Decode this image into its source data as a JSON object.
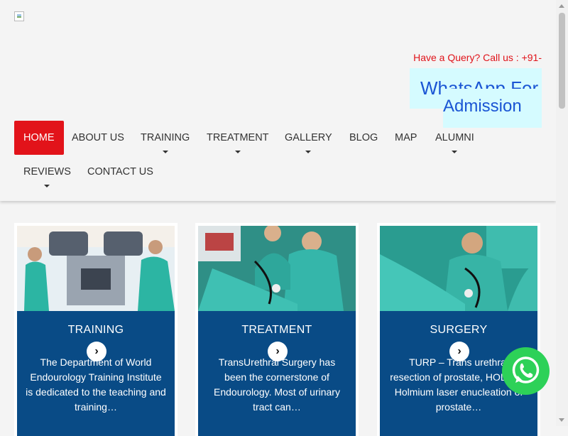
{
  "header": {
    "query_text": "Have a Query? Call us : +91-",
    "whatsapp_line1": "WhatsApp For",
    "whatsapp_line2": "Admission"
  },
  "nav": {
    "items": [
      {
        "label": "HOME",
        "active": true
      },
      {
        "label": "ABOUT US"
      },
      {
        "label": "TRAINING",
        "has_dropdown": true
      },
      {
        "label": "TREATMENT",
        "has_dropdown": true
      },
      {
        "label": "GALLERY",
        "has_dropdown": true
      },
      {
        "label": "BLOG"
      },
      {
        "label": "MAP"
      },
      {
        "label": "ALUMNI",
        "has_dropdown": true
      },
      {
        "label": "REVIEWS",
        "has_dropdown": true
      },
      {
        "label": "CONTACT US"
      }
    ]
  },
  "cards": [
    {
      "title": "TRAINING",
      "arrow": "›",
      "desc": "The Department of World Endourology Training Institute is dedicated to the teaching and training…"
    },
    {
      "title": "TREATMENT",
      "arrow": "›",
      "desc": "TransUrethral Surgery has been the cornerstone of Endourology. Most of urinary tract can…"
    },
    {
      "title": "SURGERY",
      "arrow": "›",
      "desc": "TURP – Trans urethral resection of prostate, HOLEP – Holmium laser enucleation of prostate…"
    }
  ],
  "colors": {
    "nav_active": "#e2131a",
    "card_panel": "#094b86",
    "whatsapp_green": "#2dd158",
    "query_red": "#e0131a"
  },
  "icons": {
    "logo": "broken-image-icon",
    "floating": "whatsapp-icon",
    "card_arrow": "chevron-right-icon"
  }
}
